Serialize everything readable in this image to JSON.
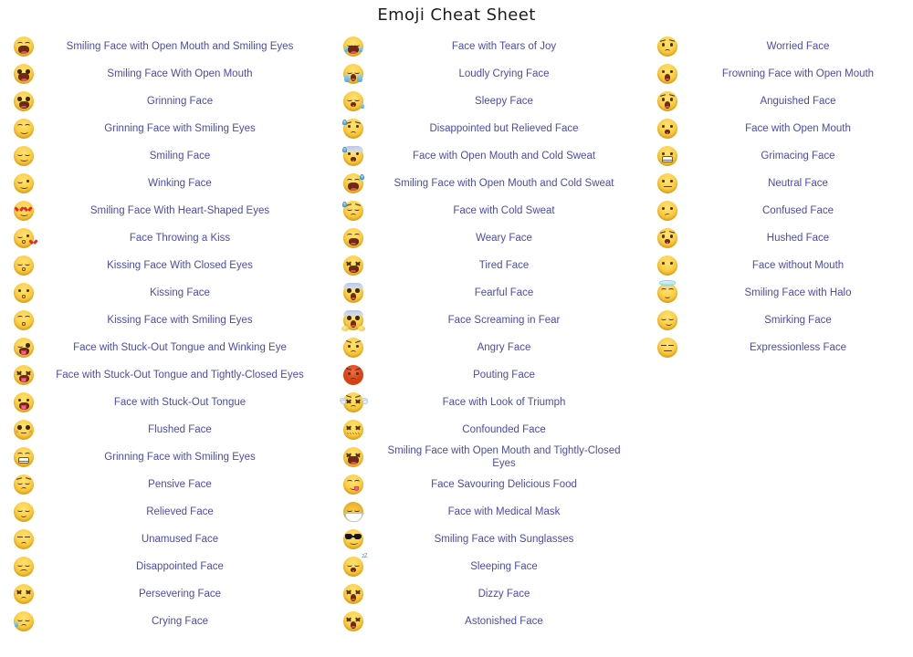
{
  "page": {
    "title": "Emoji Cheat Sheet",
    "text_color": "#4b4bad",
    "title_color": "#1c1c1c",
    "background": "#ffffff"
  },
  "columns": [
    {
      "id": "column-1",
      "items": [
        {
          "icon": "smiling-face-with-open-mouth-and-smiling-eyes",
          "label": "Smiling Face with Open Mouth and Smiling Eyes"
        },
        {
          "icon": "smiling-face-with-open-mouth",
          "label": "Smiling Face With Open Mouth"
        },
        {
          "icon": "grinning-face",
          "label": "Grinning Face"
        },
        {
          "icon": "grinning-face-with-smiling-eyes",
          "label": "Grinning Face with Smiling Eyes"
        },
        {
          "icon": "smiling-face",
          "label": "Smiling Face"
        },
        {
          "icon": "winking-face",
          "label": "Winking Face"
        },
        {
          "icon": "smiling-face-with-heart-shaped-eyes",
          "label": "Smiling Face With Heart-Shaped Eyes"
        },
        {
          "icon": "face-throwing-a-kiss",
          "label": "Face Throwing a Kiss"
        },
        {
          "icon": "kissing-face-with-closed-eyes",
          "label": "Kissing Face With Closed Eyes"
        },
        {
          "icon": "kissing-face",
          "label": "Kissing Face"
        },
        {
          "icon": "kissing-face-with-smiling-eyes",
          "label": "Kissing Face with Smiling Eyes"
        },
        {
          "icon": "face-with-stuck-out-tongue-and-winking-eye",
          "label": "Face with Stuck-Out Tongue and Winking Eye"
        },
        {
          "icon": "face-with-stuck-out-tongue-and-tightly-closed-eyes",
          "label": "Face with Stuck-Out Tongue and Tightly-Closed Eyes"
        },
        {
          "icon": "face-with-stuck-out-tongue",
          "label": "Face with Stuck-Out Tongue"
        },
        {
          "icon": "flushed-face",
          "label": "Flushed Face"
        },
        {
          "icon": "grinning-face-with-smiling-eyes-teeth",
          "label": "Grinning Face with Smiling Eyes"
        },
        {
          "icon": "pensive-face",
          "label": "Pensive Face"
        },
        {
          "icon": "relieved-face",
          "label": "Relieved Face"
        },
        {
          "icon": "unamused-face",
          "label": "Unamused Face"
        },
        {
          "icon": "disappointed-face",
          "label": "Disappointed Face"
        },
        {
          "icon": "persevering-face",
          "label": "Persevering Face"
        },
        {
          "icon": "crying-face",
          "label": "Crying Face"
        }
      ]
    },
    {
      "id": "column-2",
      "items": [
        {
          "icon": "face-with-tears-of-joy",
          "label": "Face with Tears of Joy"
        },
        {
          "icon": "loudly-crying-face",
          "label": "Loudly Crying Face"
        },
        {
          "icon": "sleepy-face",
          "label": "Sleepy Face"
        },
        {
          "icon": "disappointed-but-relieved-face",
          "label": "Disappointed but Relieved Face"
        },
        {
          "icon": "face-with-open-mouth-and-cold-sweat",
          "label": "Face with Open Mouth and Cold Sweat"
        },
        {
          "icon": "smiling-face-with-open-mouth-and-cold-sweat",
          "label": "Smiling Face with Open Mouth and Cold Sweat"
        },
        {
          "icon": "face-with-cold-sweat",
          "label": "Face with Cold Sweat"
        },
        {
          "icon": "weary-face",
          "label": "Weary Face"
        },
        {
          "icon": "tired-face",
          "label": "Tired Face"
        },
        {
          "icon": "fearful-face",
          "label": "Fearful Face"
        },
        {
          "icon": "face-screaming-in-fear",
          "label": "Face Screaming in Fear"
        },
        {
          "icon": "angry-face",
          "label": "Angry Face"
        },
        {
          "icon": "pouting-face",
          "label": "Pouting Face"
        },
        {
          "icon": "face-with-look-of-triumph",
          "label": "Face with Look of Triumph"
        },
        {
          "icon": "confounded-face",
          "label": "Confounded Face"
        },
        {
          "icon": "smiling-face-with-open-mouth-and-tightly-closed-eyes",
          "label": "Smiling Face with Open Mouth and Tightly-Closed Eyes"
        },
        {
          "icon": "face-savouring-delicious-food",
          "label": "Face Savouring Delicious Food"
        },
        {
          "icon": "face-with-medical-mask",
          "label": "Face with Medical Mask"
        },
        {
          "icon": "smiling-face-with-sunglasses",
          "label": "Smiling Face with Sunglasses"
        },
        {
          "icon": "sleeping-face",
          "label": "Sleeping Face"
        },
        {
          "icon": "dizzy-face",
          "label": "Dizzy Face"
        },
        {
          "icon": "astonished-face",
          "label": "Astonished Face"
        }
      ]
    },
    {
      "id": "column-3",
      "items": [
        {
          "icon": "worried-face",
          "label": "Worried Face"
        },
        {
          "icon": "frowning-face-with-open-mouth",
          "label": "Frowning Face with Open Mouth"
        },
        {
          "icon": "anguished-face",
          "label": "Anguished Face"
        },
        {
          "icon": "face-with-open-mouth",
          "label": "Face with Open Mouth"
        },
        {
          "icon": "grimacing-face",
          "label": "Grimacing Face"
        },
        {
          "icon": "neutral-face",
          "label": "Neutral Face"
        },
        {
          "icon": "confused-face",
          "label": "Confused Face"
        },
        {
          "icon": "hushed-face",
          "label": "Hushed Face"
        },
        {
          "icon": "face-without-mouth",
          "label": "Face without Mouth"
        },
        {
          "icon": "smiling-face-with-halo",
          "label": "Smiling Face with Halo"
        },
        {
          "icon": "smirking-face",
          "label": "Smirking Face"
        },
        {
          "icon": "expressionless-face",
          "label": "Expressionless Face"
        }
      ]
    }
  ]
}
